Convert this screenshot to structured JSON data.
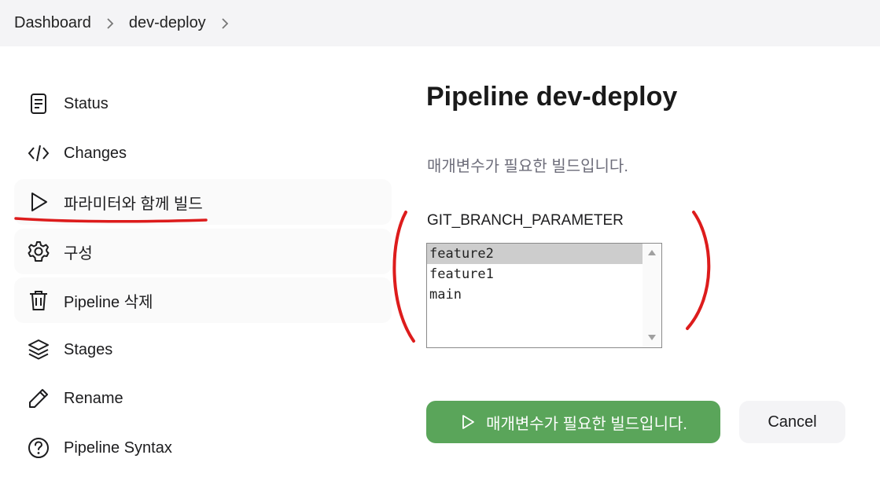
{
  "breadcrumb": {
    "items": [
      "Dashboard",
      "dev-deploy"
    ]
  },
  "sidebar": {
    "items": [
      {
        "label": "Status",
        "icon": "document-icon"
      },
      {
        "label": "Changes",
        "icon": "code-icon"
      },
      {
        "label": "파라미터와 함께 빌드",
        "icon": "play-icon"
      },
      {
        "label": "구성",
        "icon": "gear-icon"
      },
      {
        "label": "Pipeline 삭제",
        "icon": "trash-icon"
      },
      {
        "label": "Stages",
        "icon": "layers-icon"
      },
      {
        "label": "Rename",
        "icon": "pencil-icon"
      },
      {
        "label": "Pipeline Syntax",
        "icon": "help-circle-icon"
      }
    ]
  },
  "main": {
    "title": "Pipeline dev-deploy",
    "description": "매개변수가 필요한 빌드입니다.",
    "parameter": {
      "name": "GIT_BRANCH_PARAMETER",
      "options": [
        "feature2",
        "feature1",
        "main"
      ],
      "selected": "feature2"
    },
    "build_button_label": "매개변수가 필요한 빌드입니다.",
    "cancel_button_label": "Cancel"
  },
  "colors": {
    "build_button": "#5aa55a",
    "annotation_red": "#dd1c1c",
    "breadcrumb_bg": "#f4f4f6"
  }
}
